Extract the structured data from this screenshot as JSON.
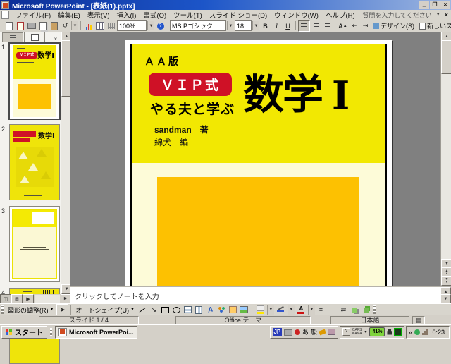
{
  "window": {
    "title": "Microsoft PowerPoint - [表紙(1).pptx]"
  },
  "menu_bar": {
    "items": [
      "ファイル(F)",
      "編集(E)",
      "表示(V)",
      "挿入(I)",
      "書式(O)",
      "ツール(T)",
      "スライド ショー(D)",
      "ウィンドウ(W)",
      "ヘルプ(H)"
    ],
    "question": "質問を入力してください"
  },
  "toolbar": {
    "zoom": "100%",
    "font_name": "MS Pゴシック",
    "font_size": "18",
    "bold": "B",
    "italic": "I",
    "underline": "U",
    "grow_font": "A",
    "help_glyph": "?",
    "design": "デザイン(S)",
    "new_slide": "新しいスライド(N)"
  },
  "slides_panel": {
    "slide_numbers": [
      "1",
      "2",
      "3",
      "4"
    ]
  },
  "slide": {
    "edition": "ＡＡ版",
    "badge": "ＶＩＰ式",
    "subtitle": "やる夫と学ぶ",
    "title_main": "数学",
    "title_numeral": "Ⅰ",
    "author1": "sandman　著",
    "author2": "綿犬　編"
  },
  "notes": {
    "placeholder": "クリックしてノートを入力"
  },
  "drawing_toolbar": {
    "adjust": "図形の調整(R)",
    "autoshapes": "オートシェイプ(U)",
    "wordart_letter": "A",
    "font_color_letter": "A"
  },
  "status_bar": {
    "slide_indicator": "スライド 1 / 4",
    "theme": "Office テーマ",
    "language": "日本語"
  },
  "taskbar": {
    "start": "スタート",
    "task": "Microsoft PowerPoi...",
    "ime_lang": "JP",
    "ime_hiragana": "あ",
    "ime_mode": "般",
    "caps": "CAPS",
    "kana": "KANA",
    "battery": "41%",
    "clock": "0:23"
  }
}
